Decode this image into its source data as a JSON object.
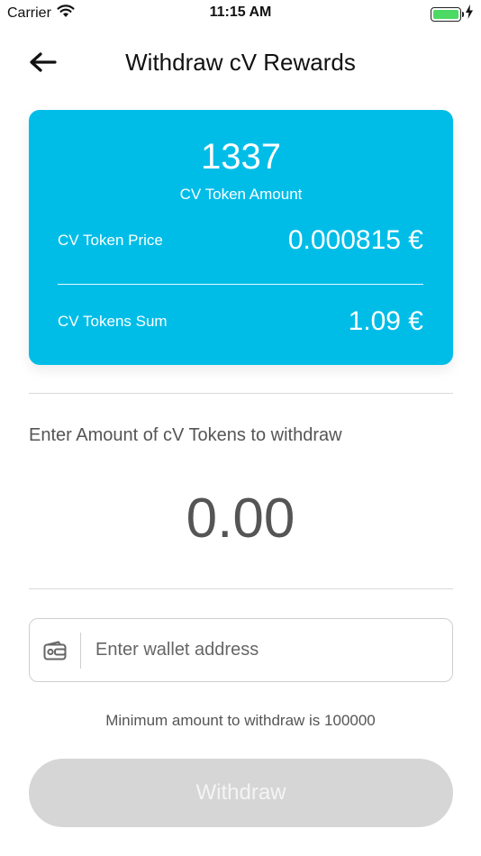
{
  "status_bar": {
    "carrier": "Carrier",
    "time": "11:15 AM",
    "wifi_icon": "wifi-icon",
    "battery_icon": "battery-icon",
    "charging_icon": "bolt-icon",
    "battery_level": 1.0,
    "battery_color": "#4cd964"
  },
  "nav": {
    "back_icon": "arrow-left-icon",
    "title": "Withdraw cV Rewards"
  },
  "summary_card": {
    "background_color": "#00bde8",
    "token_amount": "1337",
    "token_amount_label": "CV Token Amount",
    "price_label": "CV Token Price",
    "price_value": "0.000815 €",
    "sum_label": "CV Tokens Sum",
    "sum_value": "1.09 €"
  },
  "withdraw_form": {
    "instruction": "Enter Amount of cV Tokens to withdraw",
    "amount_value": "0.00",
    "wallet_icon": "wallet-icon",
    "wallet_placeholder": "Enter wallet address",
    "wallet_value": "",
    "minimum_note": "Minimum amount to withdraw is 100000",
    "submit_label": "Withdraw",
    "submit_enabled": false
  }
}
